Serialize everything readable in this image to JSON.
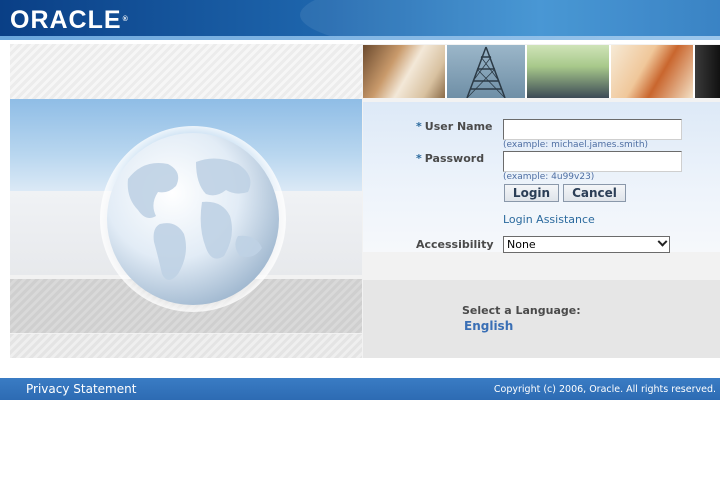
{
  "header": {
    "logo_text": "ORACLE",
    "logo_mark": "®"
  },
  "login": {
    "username_required": "*",
    "username_label": "User Name",
    "username_value": "",
    "username_hint": "(example: michael.james.smith)",
    "password_required": "*",
    "password_label": "Password",
    "password_value": "",
    "password_hint": "(example: 4u99v23)",
    "login_button": "Login",
    "cancel_button": "Cancel",
    "assistance_link": "Login Assistance",
    "accessibility_label": "Accessibility",
    "accessibility_value": "None"
  },
  "language": {
    "title": "Select a Language:",
    "options": [
      "English"
    ]
  },
  "footer": {
    "privacy": "Privacy Statement",
    "copyright": "Copyright (c) 2006, Oracle. All rights reserved."
  },
  "colors": {
    "header_blue": "#1e66ad",
    "link_blue": "#2b6a9e",
    "footer_blue": "#2d6bb3"
  }
}
